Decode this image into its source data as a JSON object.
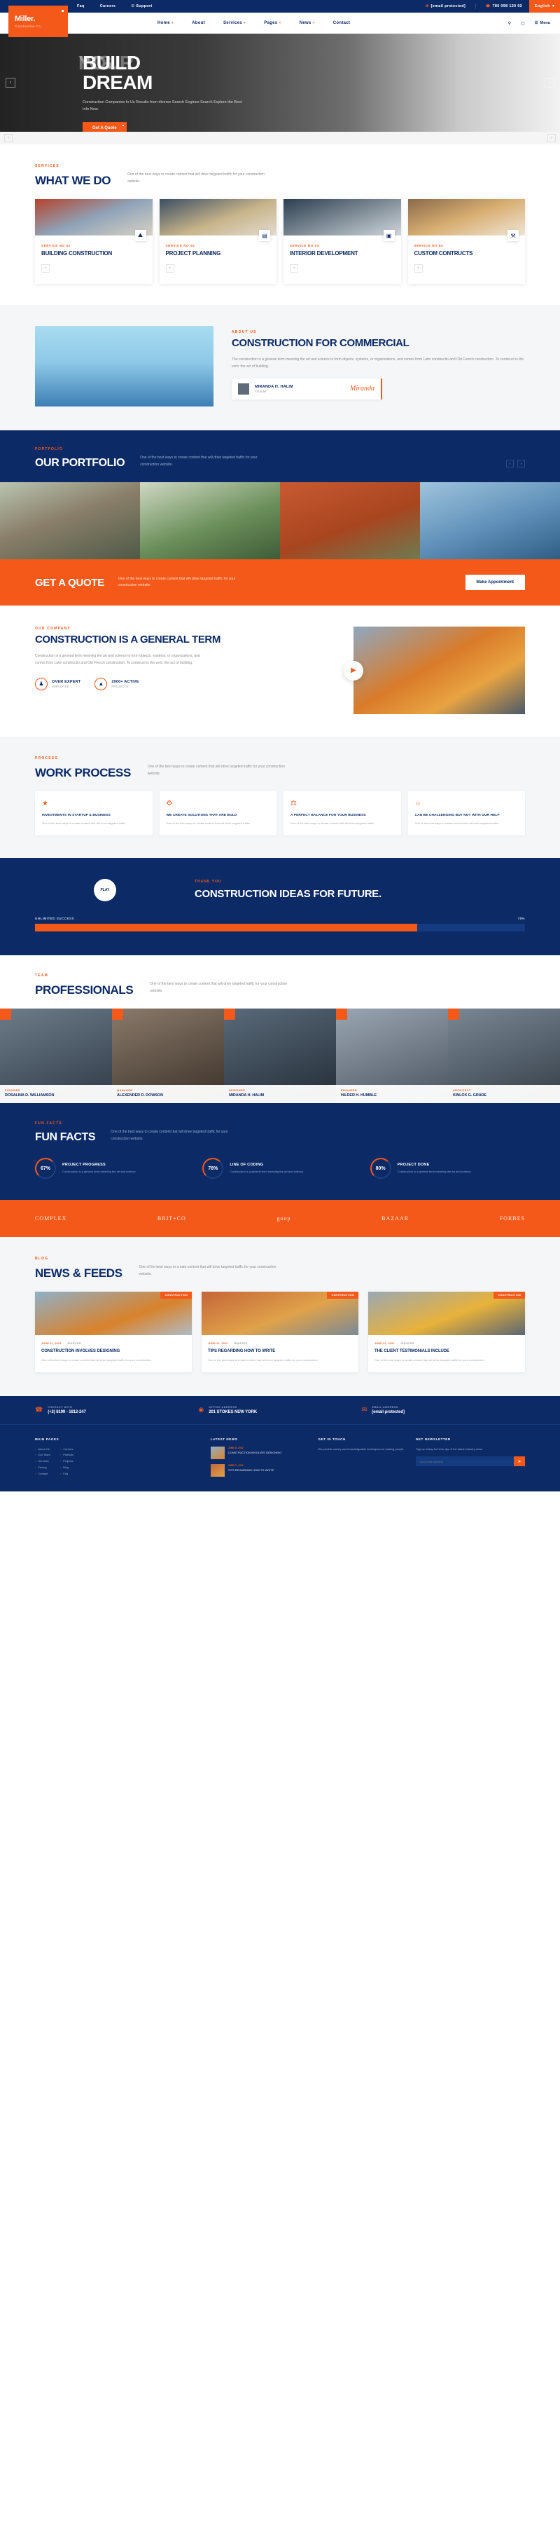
{
  "topbar": {
    "links": [
      "Faq",
      "Careers",
      "Support"
    ],
    "support_icon": "headset-icon",
    "email": "[email protected]",
    "email_icon": "envelope-icon",
    "phone": "780 098 120 92",
    "phone_icon": "phone-icon",
    "language": "English",
    "language_icon": "chevron-down-icon"
  },
  "brand": {
    "name": "Miller.",
    "tagline": "Construction Co."
  },
  "nav": {
    "items": [
      {
        "label": "Home",
        "caret": "+"
      },
      {
        "label": "About",
        "caret": ""
      },
      {
        "label": "Services",
        "caret": "+"
      },
      {
        "label": "Pages",
        "caret": "+"
      },
      {
        "label": "News",
        "caret": "+"
      },
      {
        "label": "Contact",
        "caret": ""
      }
    ],
    "search_icon": "search-icon",
    "cart_icon": "cart-icon",
    "menu_label": "Menu",
    "menu_icon": "hamburger-icon"
  },
  "hero": {
    "line1_front": "BUILD",
    "line1_back": "YOUR",
    "line2_front": "DREAM",
    "line2_back": "ING",
    "subtitle": "Construction Companies In Us Results from diverse Search Engines Search Explore the Best Info Now.",
    "cta": "Get A Quote",
    "prev_icon": "chevron-left-icon",
    "next_icon": "chevron-right-icon"
  },
  "services": {
    "label": "SERVICES",
    "title": "WHAT WE DO",
    "subtitle": "One of the best ways to create content that will drive targeted traffic for your construction website.",
    "cards": [
      {
        "no": "SERVICE NO 01",
        "title": "BUILDING CONSTRUCTION",
        "badge_icon": "helmet-icon",
        "plus_icon": "plus-icon"
      },
      {
        "no": "SERVICE NO 02",
        "title": "PROJECT PLANNING",
        "badge_icon": "blueprint-icon",
        "plus_icon": "plus-icon"
      },
      {
        "no": "SERVICE NO 03",
        "title": "INTERIOR DEVELOPMENT",
        "badge_icon": "interior-icon",
        "plus_icon": "plus-icon"
      },
      {
        "no": "SERVICE NO 04",
        "title": "CUSTOM CONTRUCTS",
        "badge_icon": "tools-icon",
        "plus_icon": "plus-icon"
      }
    ]
  },
  "commercial": {
    "label": "ABOUT US",
    "title": "CONSTRUCTION FOR COMMERCIAL",
    "body": "The construction is a general term meaning the art and science to form objects, systems, or organizations, and comes from Latin constructio and Old French construction. To construct is the verb: the act of building.",
    "person_name": "MIRANDA H. HALIM",
    "person_role": "Founder",
    "signature": "Miranda"
  },
  "portfolio": {
    "label": "PORTFOLIO",
    "title": "OUR PORTFOLIO",
    "subtitle": "One of the best ways to create content that will drive targeted traffic for your construction website.",
    "prev_icon": "chevron-left-icon",
    "next_icon": "chevron-right-icon"
  },
  "quote": {
    "title": "GET A QUOTE",
    "subtitle": "One of the best ways to create content that will drive targeted traffic for your construction website.",
    "button": "Make Appointment"
  },
  "general": {
    "label": "OUR COMPANY",
    "title": "CONSTRUCTION IS A GENERAL TERM",
    "body": "Construction is a general term meaning the art and science to form objects, systems, or organizations, and comes from Latin constructio and Old French construction. To construct is the verb: the act of building.",
    "stats": [
      {
        "icon": "people-icon",
        "t1": "OVER EXPERT",
        "t2": "EMPLOYEE"
      },
      {
        "icon": "chart-icon",
        "t1": "2000+ ACTIVE",
        "t2": "PROJECTS"
      }
    ],
    "play_icon": "play-icon"
  },
  "process": {
    "label": "PROCESS",
    "title": "WORK PROCESS",
    "subtitle": "One of the best ways to create content that will drive targeted traffic for your construction website.",
    "cards": [
      {
        "icon": "investment-icon",
        "title": "INVESTMENTS IN STARTUP & BUSINESS",
        "desc": "One of the best ways to create content that will drive targeted traffic."
      },
      {
        "icon": "solution-icon",
        "title": "WE CREATE SOLUTIONS THAT ARE BOLD",
        "desc": "One of the best ways to create content that will drive targeted traffic."
      },
      {
        "icon": "balance-icon",
        "title": "A PERFECT BALANCE FOR YOUR BUSINESS",
        "desc": "One of the best ways to create content that will drive targeted traffic."
      },
      {
        "icon": "help-icon",
        "title": "CAN BE CHALLENGING BUT NOT WITH OUR HELP",
        "desc": "One of the best ways to create content that will drive targeted traffic."
      }
    ]
  },
  "ideas": {
    "play_label": "PLAY",
    "label": "THANK YOU",
    "title": "CONSTRUCTION IDEAS FOR FUTURE.",
    "progress_label": "UNLIMITED SUCCESS",
    "progress_value": "78%",
    "progress_percent": 78
  },
  "pros": {
    "label": "TEAM",
    "title": "PROFESSIONALS",
    "subtitle": "One of the best ways to create content that will drive targeted traffic for your construction website.",
    "members": [
      {
        "role": "FOUNDER",
        "name": "ROSALINA D. WILLIAMSON"
      },
      {
        "role": "MANAGER",
        "name": "ALEXENDER D. DOWSON"
      },
      {
        "role": "DESIGNER",
        "name": "MIRANDA H. HALIM"
      },
      {
        "role": "ENGINEER",
        "name": "HILDER H. HUMBLE"
      },
      {
        "role": "ARCHITECT",
        "name": "KINLOX G. GRADE"
      }
    ]
  },
  "facts": {
    "label": "FUN FACTS",
    "title": "FUN FACTS",
    "subtitle": "One of the best ways to create content that will drive targeted traffic for your construction website.",
    "items": [
      {
        "value": "67%",
        "title": "PROJECT PROGRESS",
        "desc": "Construction is a general term meaning the art and science."
      },
      {
        "value": "78%",
        "title": "LINE OF CODING",
        "desc": "Construction is a general term meaning the art and science."
      },
      {
        "value": "80%",
        "title": "PROJECT DONE",
        "desc": "Construction is a general term meaning the art and science."
      }
    ]
  },
  "brands": [
    "COMPLEX",
    "BRIT+CO",
    "goop",
    "BAZAAR",
    "FORBES"
  ],
  "news": {
    "label": "BLOG",
    "title": "NEWS & FEEDS",
    "subtitle": "One of the best ways to create content that will drive targeted traffic for your construction website.",
    "cards": [
      {
        "badge": "CONSTRUCTION",
        "date": "JUNE 21, 2022",
        "author": "JENIFFER",
        "title": "CONSTRUCTION INVOLVES DESIGNING",
        "desc": "One of the best ways to create content that will drive targeted traffic for your construction."
      },
      {
        "badge": "CONSTRUCTION",
        "date": "JUNE 21, 2022",
        "author": "JENIFFER",
        "title": "TIPS REGARDING HOW TO WRITE",
        "desc": "One of the best ways to create content that will drive targeted traffic for your construction."
      },
      {
        "badge": "CONSTRUCTION",
        "date": "JUNE 21, 2022",
        "author": "JENIFFER",
        "title": "THE CLIENT TESTIMONIALS INCLUDE",
        "desc": "One of the best ways to create content that will drive targeted traffic for your construction."
      }
    ]
  },
  "contact_strip": [
    {
      "icon": "phone-icon",
      "label": "CONTACT WITH",
      "value": "(+2) 8199 - 1812-247"
    },
    {
      "icon": "pin-icon",
      "label": "OFFICE ADDRESS",
      "value": "201 STOKES NEW YORK"
    },
    {
      "icon": "mail-icon",
      "label": "EMAIL ADDRESS",
      "value": "[email protected]"
    }
  ],
  "footer": {
    "col1_head": "MAIN PAGES",
    "col1_a": [
      "About Us",
      "Our Team",
      "Services",
      "Pricing",
      "Contact"
    ],
    "col1_b": [
      "Careers",
      "Portfolio",
      "Projects",
      "Blog",
      "Faq"
    ],
    "col2_head": "LATEST NEWS",
    "posts": [
      {
        "date": "JUNE 21, 2022",
        "title": "CONSTRUCTION INVOLVES DESIGNING"
      },
      {
        "date": "JUNE 21, 2022",
        "title": "TIPS REGARDING HOW TO WRITE"
      }
    ],
    "col3_head": "GET IN TOUCH",
    "col3_body": "We provide variety and knowledgeable techniques for making people.",
    "col4_head": "NET NEWSLETTER",
    "col4_body": "Sign up today for hints, tips & the latest industry news.",
    "input_placeholder": "Your email address",
    "submit_icon": "send-icon"
  }
}
